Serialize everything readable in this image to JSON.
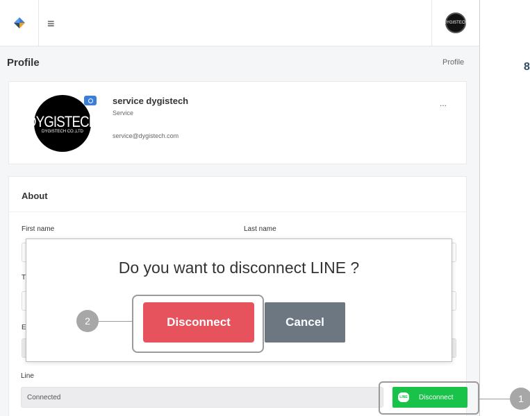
{
  "topbar": {
    "menu_icon": "hamburger-icon",
    "avatar_text": "DYGISTECH"
  },
  "page": {
    "title": "Profile",
    "breadcrumb": "Profile"
  },
  "profile": {
    "avatar_brand": "DYGISTECH",
    "avatar_sub": "DYGISTECH CO.,LTD",
    "name": "service dygistech",
    "role": "Service",
    "email": "service@dygistech.com",
    "more": "..."
  },
  "about": {
    "title": "About",
    "first_name_label": "First name",
    "last_name_label": "Last name",
    "t_label": "T",
    "e_label": "E",
    "line_label": "Line",
    "line_value": "Connected",
    "line_button": "Disconnect",
    "line_badge": "LINE"
  },
  "dialog": {
    "question": "Do you want to disconnect LINE ?",
    "disconnect": "Disconnect",
    "cancel": "Cancel"
  },
  "callouts": {
    "one": "1",
    "two": "2"
  },
  "side": {
    "text": "8"
  },
  "colors": {
    "accent": "#3b7dd8",
    "danger": "#e6535c",
    "line_green": "#19c34a",
    "cancel_grey": "#6c7781"
  }
}
